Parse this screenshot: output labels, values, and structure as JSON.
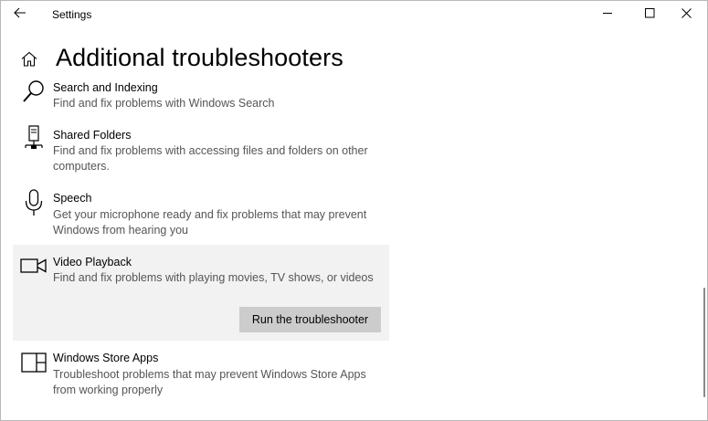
{
  "window": {
    "title": "Settings",
    "controls": {
      "minimize": "minimize-icon",
      "maximize": "maximize-icon",
      "close": "close-icon"
    }
  },
  "header": {
    "title": "Additional troubleshooters",
    "home_icon": "home-icon",
    "back_icon": "back-arrow-icon"
  },
  "troubleshooters": [
    {
      "name": "Search and Indexing",
      "description": "Find and fix problems with Windows Search",
      "icon": "search-icon"
    },
    {
      "name": "Shared Folders",
      "description": "Find and fix problems with accessing files and folders on other computers.",
      "icon": "network-computer-icon"
    },
    {
      "name": "Speech",
      "description": "Get your microphone ready and fix problems that may prevent Windows from hearing you",
      "icon": "microphone-icon"
    },
    {
      "name": "Video Playback",
      "description": "Find and fix problems with playing movies, TV shows, or videos",
      "icon": "video-camera-icon",
      "selected": true,
      "action_label": "Run the troubleshooter"
    },
    {
      "name": "Windows Store Apps",
      "description": "Troubleshoot problems that may prevent Windows Store Apps from working properly",
      "icon": "store-apps-icon"
    }
  ],
  "colors": {
    "selected_background": "#f2f2f2",
    "button_background": "#cccccc",
    "description_text": "#555555"
  }
}
